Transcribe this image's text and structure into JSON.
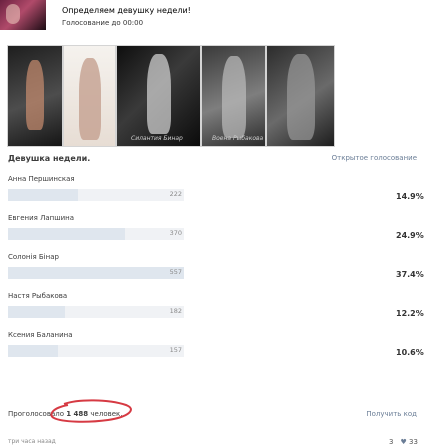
{
  "post": {
    "title": "Определяем девушку недели!",
    "subtitle": "Голосование до 00:00"
  },
  "photos": {
    "captions": [
      "Силантия Бинар",
      "Воена Рыбакова"
    ]
  },
  "poll": {
    "title": "Девушка недели.",
    "type": "Открытое голосование",
    "options": [
      {
        "name": "Анна Першинская",
        "votes": "222",
        "percent": "14.9%",
        "fraction": 0.149
      },
      {
        "name": "Евгения Лапшина",
        "votes": "370",
        "percent": "24.9%",
        "fraction": 0.249
      },
      {
        "name": "Солонія Бінар",
        "votes": "557",
        "percent": "37.4%",
        "fraction": 0.374
      },
      {
        "name": "Настя Рыбакова",
        "votes": "182",
        "percent": "12.2%",
        "fraction": 0.122
      },
      {
        "name": "Ксения Баланина",
        "votes": "157",
        "percent": "10.6%",
        "fraction": 0.106
      }
    ],
    "voted_prefix": "Проголосовало",
    "voted_count": "1 488",
    "voted_suffix": "человек.",
    "get_code": "Получить код"
  },
  "footer": {
    "time": "три часа назад",
    "comments": "3",
    "likes": "33"
  },
  "colors": {
    "bar_bg": "#f0f2f5",
    "bar_fill": "#dfe6ee",
    "link": "#6a7d96",
    "annotation": "#d63a43"
  }
}
